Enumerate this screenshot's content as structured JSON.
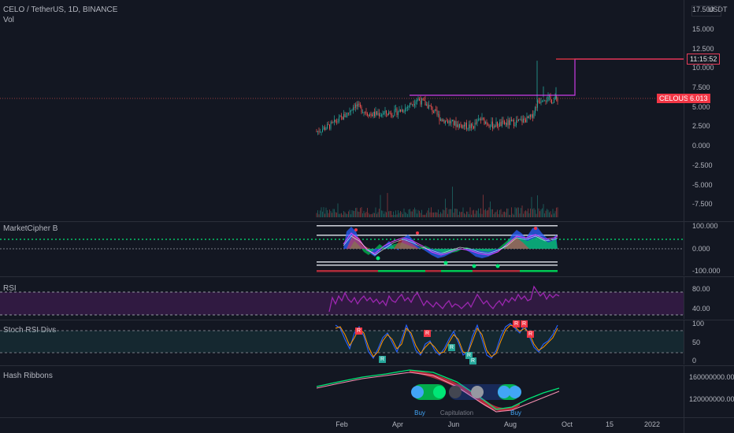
{
  "header": {
    "symbol_line": "CELO / TetherUS, 1D, BINANCE",
    "volume_label": "Vol",
    "currency": "USDT"
  },
  "price_axis": [
    "17.500",
    "15.000",
    "12.500",
    "10.000",
    "7.500",
    "5.000",
    "2.500",
    "0.000",
    "-2.500",
    "-5.000",
    "-7.500"
  ],
  "price_tags": {
    "countdown": "11:15:52",
    "countdown_color": "#e83e5a",
    "symbol_tag": "CELOUSDT",
    "last_price": "6.013",
    "tag_color": "#f23645"
  },
  "panes": {
    "market_cipher": {
      "label": "MarketCipher B",
      "ticks": [
        "100.000",
        "0.000",
        "-100.000"
      ]
    },
    "rsi": {
      "label": "RSI",
      "ticks": [
        "80.00",
        "40.00"
      ]
    },
    "stoch": {
      "label": "Stoch RSI Divs",
      "ticks": [
        "100",
        "50",
        "0"
      ],
      "tag_bear": "R",
      "tag_bull": "R"
    },
    "hash": {
      "label": "Hash Ribbons",
      "ticks": [
        "160000000.000",
        "120000000.000"
      ],
      "buy_label": "Buy",
      "capitulation_label": "Capitulation"
    }
  },
  "time_axis": [
    "Feb",
    "Apr",
    "Jun",
    "Aug",
    "Oct",
    "15",
    "2022"
  ],
  "colors": {
    "background": "#131722",
    "up": "#26a69a",
    "down": "#ef5350",
    "rsi": "#9c27b0",
    "hash_green": "#00e676",
    "hash_red": "#f23645",
    "magenta_level": "#e040fb",
    "accent": "#2962ff"
  }
}
